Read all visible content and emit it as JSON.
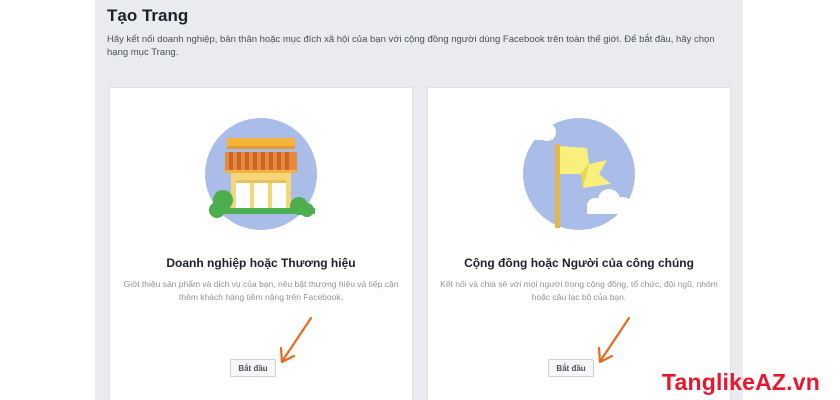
{
  "page": {
    "title": "Tạo Trang",
    "description": "Hãy kết nối doanh nghiệp, bản thân hoặc mục đích xã hội của bạn với cộng đồng người dùng Facebook trên toàn thế giới. Để bắt đầu, hãy chọn hạng mục Trang."
  },
  "cards": [
    {
      "title": "Doanh nghiệp hoặc Thương hiệu",
      "description": "Giới thiệu sản phẩm và dịch vụ của bạn, nêu bật thương hiệu và tiếp cận thêm khách hàng tiềm năng trên Facebook.",
      "button_label": "Bắt đầu",
      "icon": "storefront-icon"
    },
    {
      "title": "Cộng đồng hoặc Người của công chúng",
      "description": "Kết nối và chia sẻ với mọi người trong cộng đồng, tổ chức, đội ngũ, nhóm hoặc câu lạc bộ của bạn.",
      "button_label": "Bắt đầu",
      "icon": "flag-icon"
    }
  ],
  "watermark": "TanglikeAZ.vn",
  "colors": {
    "panel_bg": "#e9ebee",
    "card_bg": "#ffffff",
    "illustration_circle": "#aabde8",
    "awning_orange": "#e8883a",
    "flag_yellow": "#f8f07a",
    "arrow": "#e86a1f",
    "watermark": "#e8172d"
  }
}
